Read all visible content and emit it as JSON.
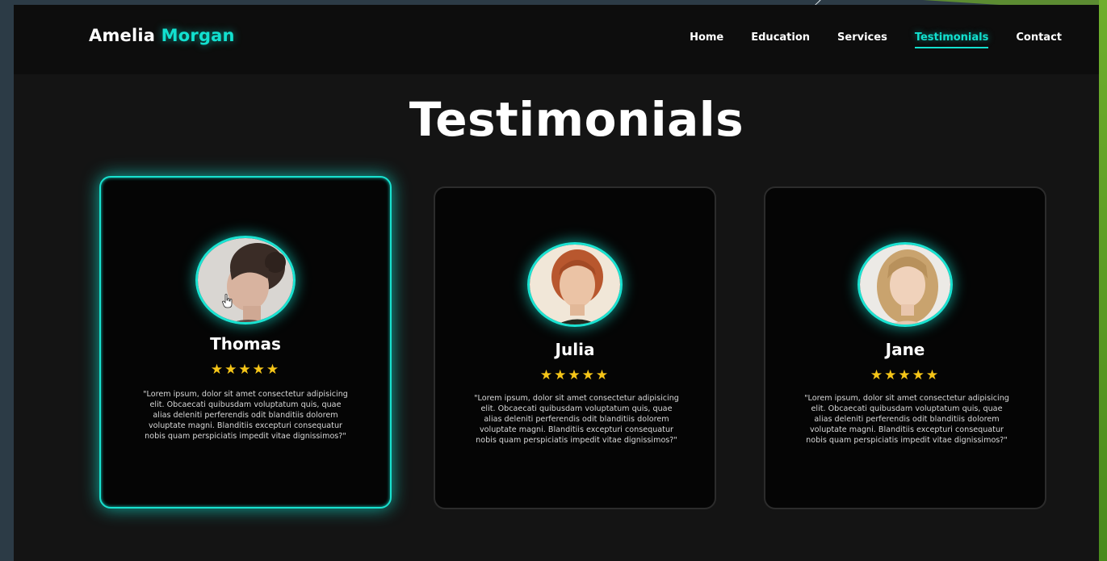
{
  "header": {
    "logo_first": "Amelia",
    "logo_last": "Morgan",
    "nav": [
      "Home",
      "Education",
      "Services",
      "Testimonials",
      "Contact"
    ],
    "active_nav": "Testimonials"
  },
  "section": {
    "title": "Testimonials"
  },
  "testimonials": [
    {
      "name": "Thomas",
      "stars": "★★★★★",
      "rating": 5,
      "quote": "\"Lorem ipsum, dolor sit amet consectetur adipisicing elit. Obcaecati quibusdam voluptatum quis, quae alias deleniti perferendis odit blanditiis dolorem voluptate magni. Blanditiis excepturi consequatur nobis quam perspiciatis impedit vitae dignissimos?\"",
      "photo_icon": "avatar-photo-dark-hair"
    },
    {
      "name": "Julia",
      "stars": "★★★★★",
      "rating": 5,
      "quote": "\"Lorem ipsum, dolor sit amet consectetur adipisicing elit. Obcaecati quibusdam voluptatum quis, quae alias deleniti perferendis odit blanditiis dolorem voluptate magni. Blanditiis excepturi consequatur nobis quam perspiciatis impedit vitae dignissimos?\"",
      "photo_icon": "avatar-photo-red-hair"
    },
    {
      "name": "Jane",
      "stars": "★★★★★",
      "rating": 5,
      "quote": "\"Lorem ipsum, dolor sit amet consectetur adipisicing elit. Obcaecati quibusdam voluptatum quis, quae alias deleniti perferendis odit blanditiis dolorem voluptate magni. Blanditiis excepturi consequatur nobis quam perspiciatis impedit vitae dignissimos?\"",
      "photo_icon": "avatar-photo-blonde-hair"
    }
  ],
  "colors": {
    "accent": "#12e0cf",
    "star": "#f5c518",
    "card_bg": "#050505",
    "page_bg": "#141414"
  }
}
